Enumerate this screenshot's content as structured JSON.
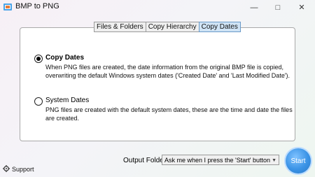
{
  "window": {
    "title": "BMP to PNG"
  },
  "tabs": [
    {
      "label": "Files & Folders",
      "active": false
    },
    {
      "label": "Copy Hierarchy",
      "active": false
    },
    {
      "label": "Copy Dates",
      "active": true
    }
  ],
  "options": [
    {
      "title": "Copy Dates",
      "selected": true,
      "description_lines": [
        "When PNG files are created, the date information from the original BMP file is copied,",
        "overwriting the default Windows system dates ('Created Date' and 'Last Modified Date')."
      ]
    },
    {
      "title": "System Dates",
      "selected": false,
      "description_lines": [
        "PNG files are created with the default system dates, these are the time and date the files",
        "are created."
      ]
    }
  ],
  "footer": {
    "support_label": "Support",
    "output_label": "Output Folder:",
    "output_value": "Ask me when I press the 'Start' button",
    "start_label": "Start"
  },
  "colors": {
    "accent": "#3a93e6",
    "tab_active": "#cfe3f5"
  },
  "icons": {
    "app": "app-icon",
    "minimize": "minimize-icon",
    "maximize": "maximize-icon",
    "close": "close-icon",
    "support": "gear-icon",
    "dropdown": "chevron-down-icon"
  }
}
